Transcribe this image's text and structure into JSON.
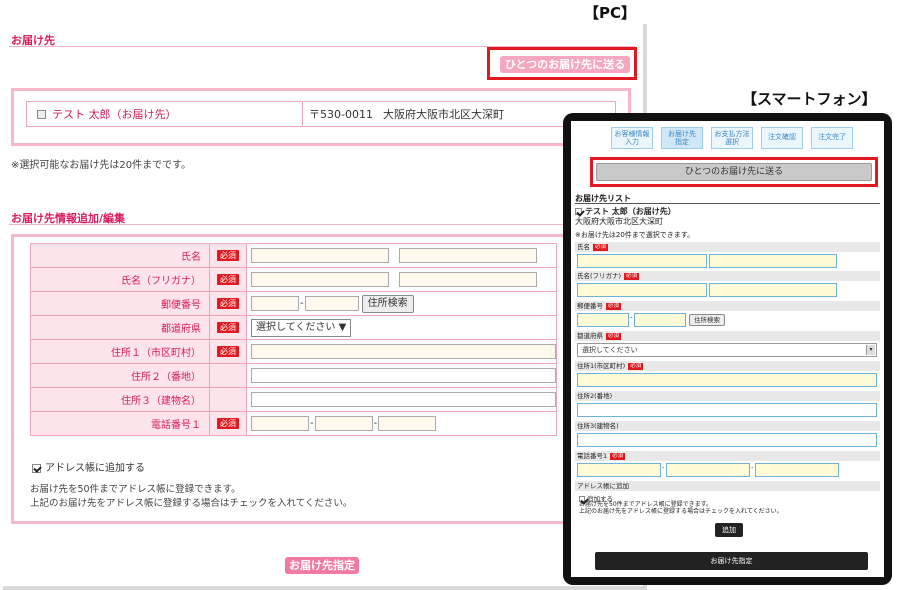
{
  "labels": {
    "pc": "【PC】",
    "smartphone": "【スマートフォン】"
  },
  "pc": {
    "section_delivery": "お届け先",
    "single_address_button": "ひとつのお届け先に送る",
    "address_entry": {
      "name": "テスト 太郎（お届け先）",
      "postal": "〒530-0011",
      "address": "大阪府大阪市北区大深町"
    },
    "limit_note": "※選択可能なお届け先は20件までです。",
    "section_add_edit": "お届け先情報追加/編集",
    "required_badge": "必須",
    "fields": {
      "name": "氏名",
      "kana": "氏名（フリガナ）",
      "postal": "郵便番号",
      "prefecture": "都道府県",
      "address1": "住所１（市区町村）",
      "address2": "住所２（番地）",
      "address3": "住所３（建物名）",
      "phone": "電話番号１"
    },
    "address_search_button": "住所検索",
    "prefecture_select": "選択してください",
    "add_to_book": "アドレス帳に追加する",
    "book_note_1": "お届け先を50件までアドレス帳に登録できます。",
    "book_note_2": "上記のお届け先をアドレス帳に登録する場合はチェックを入れてください。",
    "submit_button": "お届け先指定"
  },
  "sp": {
    "steps": [
      {
        "line1": "お客様情報",
        "line2": "入力"
      },
      {
        "line1": "お届け先",
        "line2": "指定"
      },
      {
        "line1": "お支払方法",
        "line2": "選択"
      },
      {
        "line1": "注文確認",
        "line2": ""
      },
      {
        "line1": "注文完了",
        "line2": ""
      }
    ],
    "single_address_button": "ひとつのお届け先に送る",
    "list_title": "お届け先リスト",
    "entry_name": "テスト 太郎（お届け先）",
    "entry_address": "大阪府大阪市北区大深町",
    "limit_note": "※お届け先は20件まで選択できます。",
    "required_badge": "必須",
    "fields": {
      "name": "氏名",
      "kana": "氏名(フリガナ)",
      "postal": "郵便番号",
      "prefecture": "都道府県",
      "address1": "住所1(市区町村)",
      "address2": "住所2(番地)",
      "address3": "住所3(建物名)",
      "phone": "電話番号1",
      "book": "アドレス帳に追加"
    },
    "address_search_button": "住所検索",
    "prefecture_select": "選択してください",
    "add_check": "追加する",
    "book_note_1": "お届け先を50件までアドレス帳に登録できます。",
    "book_note_2": "上記のお届け先をアドレス帳に登録する場合はチェックを入れてください。",
    "add_button": "追加",
    "submit_button": "お届け先指定"
  },
  "colors": {
    "accent_pink": "#d81b60",
    "button_pink": "#f6a6bf",
    "highlight_red": "#e0191e",
    "step_blue": "#3a86c8"
  }
}
